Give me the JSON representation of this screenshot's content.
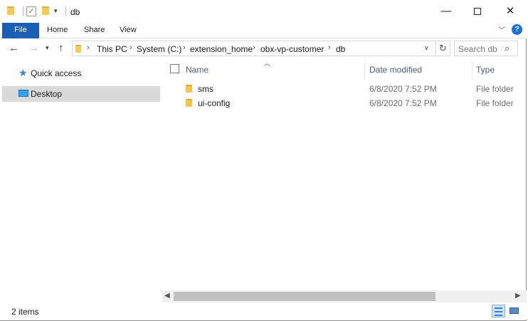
{
  "window": {
    "title": "db",
    "minimize_glyph": "—",
    "close_glyph": "✕"
  },
  "ribbon": {
    "tabs": [
      {
        "label": "File"
      },
      {
        "label": "Home"
      },
      {
        "label": "Share"
      },
      {
        "label": "View"
      }
    ],
    "help_glyph": "?"
  },
  "address": {
    "crumbs": [
      "This PC",
      "System (C:)",
      "extension_home",
      "obx-vp-customer",
      "db"
    ],
    "search_placeholder": "Search db"
  },
  "nav": {
    "items": [
      {
        "label": "Quick access",
        "icon": "star-icon"
      },
      {
        "label": "Desktop",
        "icon": "desktop-icon",
        "selected": true
      }
    ]
  },
  "columns": {
    "name": "Name",
    "date": "Date modified",
    "type": "Type"
  },
  "files": [
    {
      "name": "sms",
      "date": "6/8/2020 7:52 PM",
      "type": "File folder"
    },
    {
      "name": "ui-config",
      "date": "6/8/2020 7:52 PM",
      "type": "File folder"
    }
  ],
  "status": {
    "item_count": "2 items"
  },
  "colors": {
    "accent": "#1a5fb4",
    "selection": "#d9d9d9",
    "folder": "#f3c54b"
  }
}
